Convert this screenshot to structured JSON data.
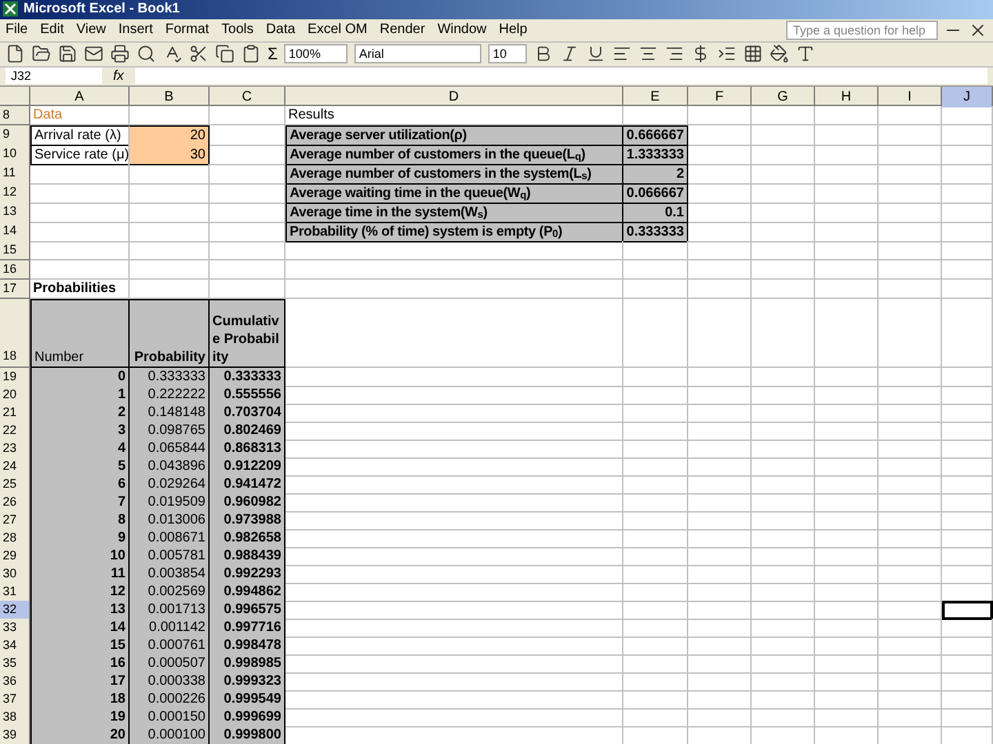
{
  "window": {
    "title": "Microsoft Excel - Book1"
  },
  "menu": [
    "File",
    "Edit",
    "View",
    "Insert",
    "Format",
    "Tools",
    "Data",
    "Excel OM",
    "Render",
    "Window",
    "Help"
  ],
  "help_field": {
    "placeholder": "Type a question for help"
  },
  "toolbar": {
    "sum": "Σ",
    "zoom": "100%",
    "font": "Arial",
    "font_size": "10"
  },
  "formula_bar": {
    "name_box": "J32",
    "fx": "fx"
  },
  "columns": [
    {
      "label": "A",
      "selected": false
    },
    {
      "label": "B",
      "selected": false
    },
    {
      "label": "C",
      "selected": false
    },
    {
      "label": "D",
      "selected": false
    },
    {
      "label": "E",
      "selected": false
    },
    {
      "label": "F",
      "selected": false
    },
    {
      "label": "G",
      "selected": false
    },
    {
      "label": "H",
      "selected": false
    },
    {
      "label": "I",
      "selected": false
    },
    {
      "label": "J",
      "selected": true
    }
  ],
  "rows": [
    {
      "number": "8",
      "selected": false
    },
    {
      "number": "9",
      "selected": false
    },
    {
      "number": "10",
      "selected": false
    },
    {
      "number": "11",
      "selected": false
    },
    {
      "number": "12",
      "selected": false
    },
    {
      "number": "13",
      "selected": false
    },
    {
      "number": "14",
      "selected": false
    },
    {
      "number": "15",
      "selected": false
    },
    {
      "number": "16",
      "selected": false
    },
    {
      "number": "17",
      "selected": false
    },
    {
      "number": "18",
      "selected": false
    },
    {
      "number": "19",
      "selected": false
    },
    {
      "number": "20",
      "selected": false
    },
    {
      "number": "21",
      "selected": false
    },
    {
      "number": "22",
      "selected": false
    },
    {
      "number": "23",
      "selected": false
    },
    {
      "number": "24",
      "selected": false
    },
    {
      "number": "25",
      "selected": false
    },
    {
      "number": "26",
      "selected": false
    },
    {
      "number": "27",
      "selected": false
    },
    {
      "number": "28",
      "selected": false
    },
    {
      "number": "29",
      "selected": false
    },
    {
      "number": "30",
      "selected": false
    },
    {
      "number": "31",
      "selected": false
    },
    {
      "number": "32",
      "selected": true
    },
    {
      "number": "33",
      "selected": false
    },
    {
      "number": "34",
      "selected": false
    },
    {
      "number": "35",
      "selected": false
    },
    {
      "number": "36",
      "selected": false
    },
    {
      "number": "37",
      "selected": false
    },
    {
      "number": "38",
      "selected": false
    },
    {
      "number": "39",
      "selected": false
    }
  ],
  "data": {
    "title": "Data",
    "items": [
      {
        "label": "Arrival rate (λ)",
        "value": "20"
      },
      {
        "label": "Service rate (μ)",
        "value": "30"
      }
    ]
  },
  "results": {
    "title": "Results",
    "items": [
      {
        "label": "Average server utilization(ρ)",
        "value": "0.666667"
      },
      {
        "label": "Average number of customers in the queue(L$_{q}$)",
        "value": "1.333333"
      },
      {
        "label": "Average number of customers in the system(L$_{s}$)",
        "value": "2"
      },
      {
        "label": "Average waiting time in the queue(W$_{q}$)",
        "value": "0.066667"
      },
      {
        "label": "Average time in the system(W$_{s}$)",
        "value": "0.1"
      },
      {
        "label": "Probability (% of time) system is empty (P$_{0}$)",
        "value": "0.333333"
      }
    ]
  },
  "probabilities": {
    "title": "Probabilities",
    "headers": [
      "Number",
      "Probability",
      "Cumulative Probability"
    ],
    "rows": [
      {
        "number": "0",
        "probability": "0.333333",
        "cumulative": "0.333333"
      },
      {
        "number": "1",
        "probability": "0.222222",
        "cumulative": "0.555556"
      },
      {
        "number": "2",
        "probability": "0.148148",
        "cumulative": "0.703704"
      },
      {
        "number": "3",
        "probability": "0.098765",
        "cumulative": "0.802469"
      },
      {
        "number": "4",
        "probability": "0.065844",
        "cumulative": "0.868313"
      },
      {
        "number": "5",
        "probability": "0.043896",
        "cumulative": "0.912209"
      },
      {
        "number": "6",
        "probability": "0.029264",
        "cumulative": "0.941472"
      },
      {
        "number": "7",
        "probability": "0.019509",
        "cumulative": "0.960982"
      },
      {
        "number": "8",
        "probability": "0.013006",
        "cumulative": "0.973988"
      },
      {
        "number": "9",
        "probability": "0.008671",
        "cumulative": "0.982658"
      },
      {
        "number": "10",
        "probability": "0.005781",
        "cumulative": "0.988439"
      },
      {
        "number": "11",
        "probability": "0.003854",
        "cumulative": "0.992293"
      },
      {
        "number": "12",
        "probability": "0.002569",
        "cumulative": "0.994862"
      },
      {
        "number": "13",
        "probability": "0.001713",
        "cumulative": "0.996575"
      },
      {
        "number": "14",
        "probability": "0.001142",
        "cumulative": "0.997716"
      },
      {
        "number": "15",
        "probability": "0.000761",
        "cumulative": "0.998478"
      },
      {
        "number": "16",
        "probability": "0.000507",
        "cumulative": "0.998985"
      },
      {
        "number": "17",
        "probability": "0.000338",
        "cumulative": "0.999323"
      },
      {
        "number": "18",
        "probability": "0.000226",
        "cumulative": "0.999549"
      },
      {
        "number": "19",
        "probability": "0.000150",
        "cumulative": "0.999699"
      },
      {
        "number": "20",
        "probability": "0.000100",
        "cumulative": "0.999800"
      }
    ]
  }
}
